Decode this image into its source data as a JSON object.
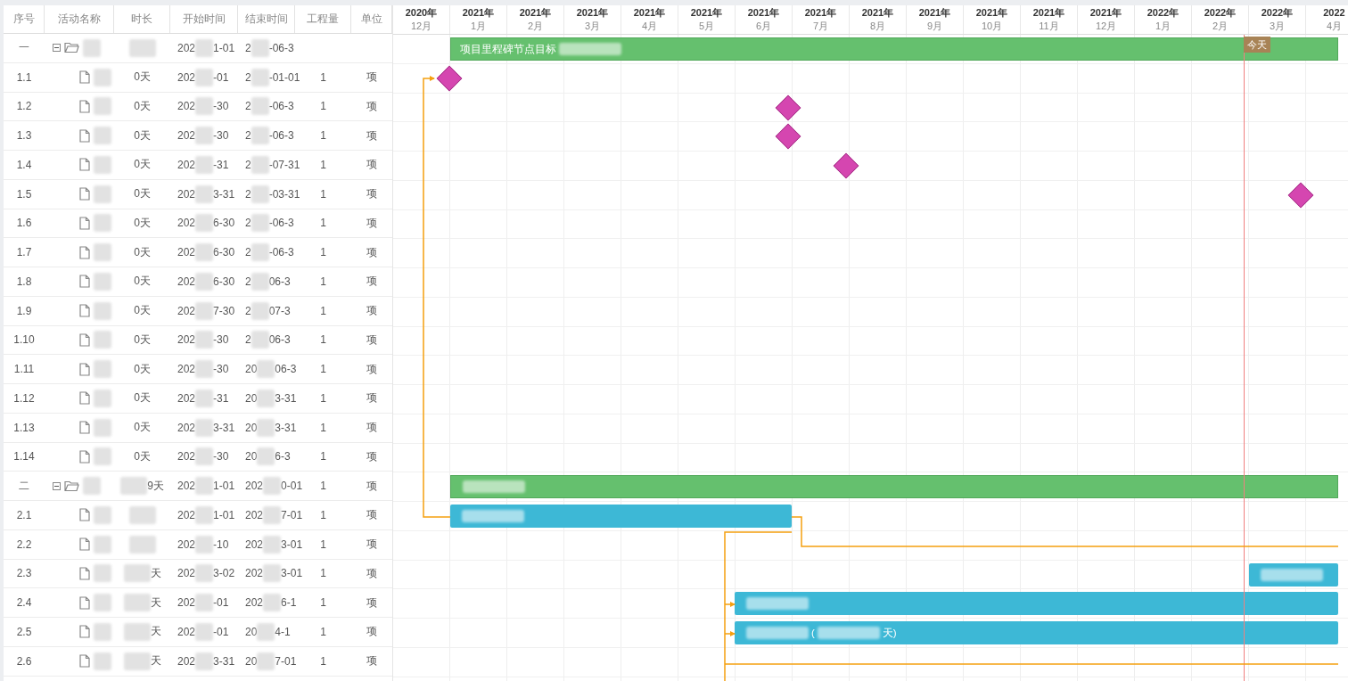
{
  "table": {
    "columns": [
      "序号",
      "活动名称",
      "时长",
      "开始时间",
      "结束时间",
      "工程量",
      "单位"
    ],
    "rows": [
      {
        "index": "一",
        "kind": "group",
        "expanded": true,
        "name": [
          {
            "kind": "blur"
          }
        ],
        "duration": [
          {
            "kind": "blur"
          }
        ],
        "start": [
          "202",
          {
            "kind": "blur"
          },
          "1-01"
        ],
        "end": [
          "2",
          {
            "kind": "blur"
          },
          "-06-3"
        ]
      },
      {
        "index": "1.1",
        "kind": "task",
        "name": [
          {
            "kind": "blur"
          }
        ],
        "duration": [
          "0天"
        ],
        "start": [
          "202",
          {
            "kind": "blur"
          },
          "-01"
        ],
        "end": [
          "2",
          {
            "kind": "blur"
          },
          "-01-01"
        ],
        "quantity": "1",
        "unit": "项"
      },
      {
        "index": "1.2",
        "kind": "task",
        "name": [
          {
            "kind": "blur"
          }
        ],
        "duration": [
          "0天"
        ],
        "start": [
          "202",
          {
            "kind": "blur"
          },
          "-30"
        ],
        "end": [
          "2",
          {
            "kind": "blur"
          },
          "-06-3"
        ],
        "quantity": "1",
        "unit": "项"
      },
      {
        "index": "1.3",
        "kind": "task",
        "name": [
          {
            "kind": "blur"
          }
        ],
        "duration": [
          "0天"
        ],
        "start": [
          "202",
          {
            "kind": "blur"
          },
          "-30"
        ],
        "end": [
          "2",
          {
            "kind": "blur"
          },
          "-06-3"
        ],
        "quantity": "1",
        "unit": "项"
      },
      {
        "index": "1.4",
        "kind": "task",
        "name": [
          {
            "kind": "blur"
          }
        ],
        "duration": [
          "0天"
        ],
        "start": [
          "202",
          {
            "kind": "blur"
          },
          "-31"
        ],
        "end": [
          "2",
          {
            "kind": "blur"
          },
          "-07-31"
        ],
        "quantity": "1",
        "unit": "项"
      },
      {
        "index": "1.5",
        "kind": "task",
        "name": [
          {
            "kind": "blur"
          }
        ],
        "duration": [
          "0天"
        ],
        "start": [
          "202",
          {
            "kind": "blur"
          },
          "3-31"
        ],
        "end": [
          "2",
          {
            "kind": "blur"
          },
          "-03-31"
        ],
        "quantity": "1",
        "unit": "项"
      },
      {
        "index": "1.6",
        "kind": "task",
        "name": [
          {
            "kind": "blur"
          }
        ],
        "duration": [
          "0天"
        ],
        "start": [
          "202",
          {
            "kind": "blur"
          },
          "6-30"
        ],
        "end": [
          "2",
          {
            "kind": "blur"
          },
          "-06-3"
        ],
        "quantity": "1",
        "unit": "项"
      },
      {
        "index": "1.7",
        "kind": "task",
        "name": [
          {
            "kind": "blur"
          }
        ],
        "duration": [
          "0天"
        ],
        "start": [
          "202",
          {
            "kind": "blur"
          },
          "6-30"
        ],
        "end": [
          "2",
          {
            "kind": "blur"
          },
          "-06-3"
        ],
        "quantity": "1",
        "unit": "项"
      },
      {
        "index": "1.8",
        "kind": "task",
        "name": [
          {
            "kind": "blur"
          }
        ],
        "duration": [
          "0天"
        ],
        "start": [
          "202",
          {
            "kind": "blur"
          },
          "6-30"
        ],
        "end": [
          "2",
          {
            "kind": "blur"
          },
          "06-3"
        ],
        "quantity": "1",
        "unit": "项"
      },
      {
        "index": "1.9",
        "kind": "task",
        "name": [
          {
            "kind": "blur"
          }
        ],
        "duration": [
          "0天"
        ],
        "start": [
          "202",
          {
            "kind": "blur"
          },
          "7-30"
        ],
        "end": [
          "2",
          {
            "kind": "blur"
          },
          "07-3"
        ],
        "quantity": "1",
        "unit": "项"
      },
      {
        "index": "1.10",
        "kind": "task",
        "name": [
          {
            "kind": "blur"
          }
        ],
        "duration": [
          "0天"
        ],
        "start": [
          "202",
          {
            "kind": "blur"
          },
          "-30"
        ],
        "end": [
          "2",
          {
            "kind": "blur"
          },
          "06-3"
        ],
        "quantity": "1",
        "unit": "项"
      },
      {
        "index": "1.11",
        "kind": "task",
        "name": [
          {
            "kind": "blur"
          }
        ],
        "duration": [
          "0天"
        ],
        "start": [
          "202",
          {
            "kind": "blur"
          },
          "-30"
        ],
        "end": [
          "20",
          {
            "kind": "blur"
          },
          "06-3"
        ],
        "quantity": "1",
        "unit": "项"
      },
      {
        "index": "1.12",
        "kind": "task",
        "name": [
          {
            "kind": "blur"
          }
        ],
        "duration": [
          "0天"
        ],
        "start": [
          "202",
          {
            "kind": "blur"
          },
          "-31"
        ],
        "end": [
          "20",
          {
            "kind": "blur"
          },
          "3-31"
        ],
        "quantity": "1",
        "unit": "项"
      },
      {
        "index": "1.13",
        "kind": "task",
        "name": [
          {
            "kind": "blur"
          }
        ],
        "duration": [
          "0天"
        ],
        "start": [
          "202",
          {
            "kind": "blur"
          },
          "3-31"
        ],
        "end": [
          "20",
          {
            "kind": "blur"
          },
          "3-31"
        ],
        "quantity": "1",
        "unit": "项"
      },
      {
        "index": "1.14",
        "kind": "task",
        "name": [
          {
            "kind": "blur"
          }
        ],
        "duration": [
          "0天"
        ],
        "start": [
          "202",
          {
            "kind": "blur"
          },
          "-30"
        ],
        "end": [
          "20",
          {
            "kind": "blur"
          },
          "6-3"
        ],
        "quantity": "1",
        "unit": "项"
      },
      {
        "index": "二",
        "kind": "group",
        "expanded": true,
        "name": [
          {
            "kind": "blur"
          }
        ],
        "duration": [
          {
            "kind": "blur"
          },
          "9天"
        ],
        "start": [
          "202",
          {
            "kind": "blur"
          },
          "1-01"
        ],
        "end": [
          "202",
          {
            "kind": "blur"
          },
          "0-01"
        ],
        "quantity": "1",
        "unit": "项"
      },
      {
        "index": "2.1",
        "kind": "task",
        "name": [
          {
            "kind": "blur"
          }
        ],
        "duration": [
          {
            "kind": "blur"
          }
        ],
        "start": [
          "202",
          {
            "kind": "blur"
          },
          "1-01"
        ],
        "end": [
          "202",
          {
            "kind": "blur"
          },
          "7-01"
        ],
        "quantity": "1",
        "unit": "项"
      },
      {
        "index": "2.2",
        "kind": "task",
        "name": [
          {
            "kind": "blur"
          }
        ],
        "duration": [
          {
            "kind": "blur"
          }
        ],
        "start": [
          "202",
          {
            "kind": "blur"
          },
          "-10"
        ],
        "end": [
          "202",
          {
            "kind": "blur"
          },
          "3-01"
        ],
        "quantity": "1",
        "unit": "项"
      },
      {
        "index": "2.3",
        "kind": "task",
        "name": [
          {
            "kind": "blur"
          }
        ],
        "duration": [
          {
            "kind": "blur"
          },
          "天"
        ],
        "start": [
          "202",
          {
            "kind": "blur"
          },
          "3-02"
        ],
        "end": [
          "202",
          {
            "kind": "blur"
          },
          "3-01"
        ],
        "quantity": "1",
        "unit": "项"
      },
      {
        "index": "2.4",
        "kind": "task",
        "name": [
          {
            "kind": "blur"
          }
        ],
        "duration": [
          {
            "kind": "blur"
          },
          "天"
        ],
        "start": [
          "202",
          {
            "kind": "blur"
          },
          "-01"
        ],
        "end": [
          "202",
          {
            "kind": "blur"
          },
          "6-1"
        ],
        "quantity": "1",
        "unit": "项"
      },
      {
        "index": "2.5",
        "kind": "task",
        "name": [
          {
            "kind": "blur"
          }
        ],
        "duration": [
          {
            "kind": "blur"
          },
          "天"
        ],
        "start": [
          "202",
          {
            "kind": "blur"
          },
          "-01"
        ],
        "end": [
          "20",
          {
            "kind": "blur"
          },
          "4-1"
        ],
        "quantity": "1",
        "unit": "项"
      },
      {
        "index": "2.6",
        "kind": "task",
        "name": [
          {
            "kind": "blur"
          }
        ],
        "duration": [
          {
            "kind": "blur"
          },
          "天"
        ],
        "start": [
          "202",
          {
            "kind": "blur"
          },
          "3-31"
        ],
        "end": [
          "20",
          {
            "kind": "blur"
          },
          "7-01"
        ],
        "quantity": "1",
        "unit": "项"
      }
    ]
  },
  "gantt": {
    "months": [
      {
        "year": "2020年",
        "month": "12月"
      },
      {
        "year": "2021年",
        "month": "1月"
      },
      {
        "year": "2021年",
        "month": "2月"
      },
      {
        "year": "2021年",
        "month": "3月"
      },
      {
        "year": "2021年",
        "month": "4月"
      },
      {
        "year": "2021年",
        "month": "5月"
      },
      {
        "year": "2021年",
        "month": "6月"
      },
      {
        "year": "2021年",
        "month": "7月"
      },
      {
        "year": "2021年",
        "month": "8月"
      },
      {
        "year": "2021年",
        "month": "9月"
      },
      {
        "year": "2021年",
        "month": "10月"
      },
      {
        "year": "2021年",
        "month": "11月"
      },
      {
        "year": "2021年",
        "month": "12月"
      },
      {
        "year": "2022年",
        "month": "1月"
      },
      {
        "year": "2022年",
        "month": "2月"
      },
      {
        "year": "2022年",
        "month": "3月"
      },
      {
        "year": "2022",
        "month": "4月"
      }
    ],
    "today": {
      "label": "今天"
    },
    "bars": [
      {
        "kind": "summary",
        "label": [
          "项目里程碑节点目标",
          {
            "kind": "blur"
          }
        ]
      },
      {
        "kind": "milestone"
      },
      {
        "kind": "milestone"
      },
      {
        "kind": "milestone"
      },
      {
        "kind": "milestone"
      },
      {
        "kind": "milestone"
      },
      {
        "kind": "none"
      },
      {
        "kind": "none"
      },
      {
        "kind": "none"
      },
      {
        "kind": "none"
      },
      {
        "kind": "none"
      },
      {
        "kind": "none"
      },
      {
        "kind": "none"
      },
      {
        "kind": "none"
      },
      {
        "kind": "none"
      },
      {
        "kind": "summary",
        "label": [
          {
            "kind": "blur"
          }
        ]
      },
      {
        "kind": "task",
        "label": [
          {
            "kind": "blur"
          }
        ]
      },
      {
        "kind": "none"
      },
      {
        "kind": "task",
        "label": [
          {
            "kind": "blur"
          }
        ]
      },
      {
        "kind": "task",
        "label": [
          {
            "kind": "blur"
          }
        ]
      },
      {
        "kind": "task",
        "label": [
          {
            "kind": "blur"
          },
          "(",
          {
            "kind": "blur"
          },
          "天)"
        ]
      },
      {
        "kind": "none"
      }
    ]
  }
}
